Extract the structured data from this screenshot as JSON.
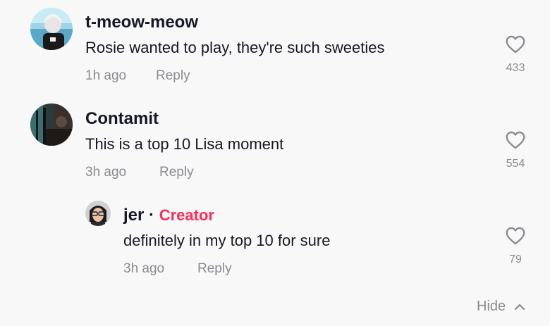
{
  "comments": [
    {
      "username": "t-meow-meow",
      "text": "Rosie wanted to play, they're such sweeties",
      "time": "1h ago",
      "reply_label": "Reply",
      "likes": "433"
    },
    {
      "username": "Contamit",
      "text": "This is a top 10 Lisa moment",
      "time": "3h ago",
      "reply_label": "Reply",
      "likes": "554"
    }
  ],
  "reply": {
    "username": "jer",
    "separator": "·",
    "badge": "Creator",
    "text": "definitely in my top 10 for sure",
    "time": "3h ago",
    "reply_label": "Reply",
    "likes": "79"
  },
  "hide_label": "Hide",
  "colors": {
    "background": "#f8f8f8",
    "text": "#161823",
    "secondary": "#8a8b91",
    "creator": "#fe2c55"
  },
  "icons": {
    "like": "heart-outline-icon",
    "hide": "chevron-up-icon"
  }
}
